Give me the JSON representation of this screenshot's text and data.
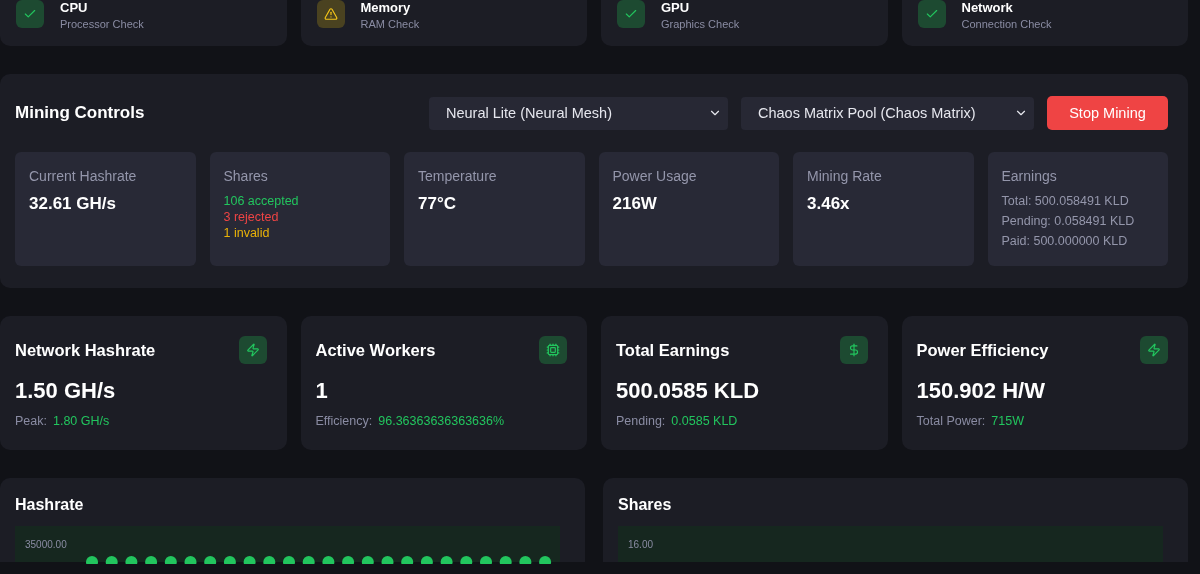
{
  "checks": [
    {
      "title": "CPU",
      "subtitle": "Processor Check",
      "kind": "ok"
    },
    {
      "title": "Memory",
      "subtitle": "RAM Check",
      "kind": "warning"
    },
    {
      "title": "GPU",
      "subtitle": "Graphics Check",
      "kind": "ok"
    },
    {
      "title": "Network",
      "subtitle": "Connection Check",
      "kind": "ok"
    }
  ],
  "mining_controls": {
    "title": "Mining Controls",
    "algorithm_select": "Neural Lite (Neural Mesh)",
    "pool_select": "Chaos Matrix Pool (Chaos Matrix)",
    "stop_button": "Stop Mining",
    "stats": [
      {
        "kind": "value",
        "label": "Current Hashrate",
        "value": "32.61 GH/s"
      },
      {
        "kind": "shares",
        "label": "Shares",
        "lines": [
          {
            "kind": "accepted",
            "text": "106 accepted"
          },
          {
            "kind": "rejected",
            "text": "3 rejected"
          },
          {
            "kind": "invalid",
            "text": "1 invalid"
          }
        ]
      },
      {
        "kind": "value",
        "label": "Temperature",
        "value": "77°C"
      },
      {
        "kind": "value",
        "label": "Power Usage",
        "value": "216W"
      },
      {
        "kind": "value",
        "label": "Mining Rate",
        "value": "3.46x"
      },
      {
        "kind": "lines",
        "label": "Earnings",
        "lines": [
          {
            "text": "Total: 500.058491 KLD"
          },
          {
            "text": "Pending: 0.058491 KLD"
          },
          {
            "text": "Paid: 500.000000 KLD"
          }
        ]
      }
    ]
  },
  "summary_cards": [
    {
      "title": "Network Hashrate",
      "value": "1.50 GH/s",
      "sub_label": "Peak:",
      "sub_value": "1.80 GH/s"
    },
    {
      "title": "Active Workers",
      "value": "1",
      "sub_label": "Efficiency:",
      "sub_value": "96.36363636363636%"
    },
    {
      "title": "Total Earnings",
      "value": "500.0585 KLD",
      "sub_label": "Pending:",
      "sub_value": "0.0585 KLD"
    },
    {
      "title": "Power Efficiency",
      "value": "150.902 H/W",
      "sub_label": "Total Power:",
      "sub_value": "715W"
    }
  ],
  "charts": [
    {
      "title": "Hashrate",
      "top_tick": "35000.00"
    },
    {
      "title": "Shares",
      "top_tick": "16.00"
    }
  ]
}
